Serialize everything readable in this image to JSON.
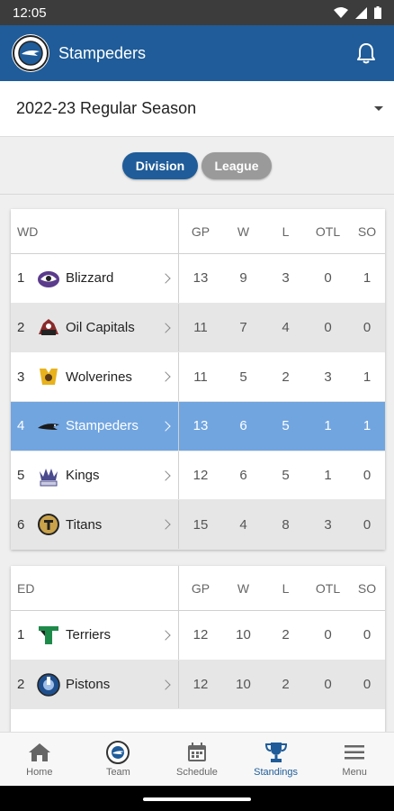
{
  "status_bar": {
    "time": "12:05"
  },
  "app_bar": {
    "title": "Stampeders"
  },
  "season_select": {
    "value": "2022-23 Regular Season"
  },
  "view_toggle": {
    "options": [
      {
        "label": "Division"
      },
      {
        "label": "League"
      }
    ]
  },
  "columns": [
    "GP",
    "W",
    "L",
    "OTL",
    "SO"
  ],
  "divisions": [
    {
      "name": "WD",
      "rows": [
        {
          "rank": "1",
          "team": "Blizzard",
          "logo": "blizzard-logo-icon",
          "gp": "13",
          "w": "9",
          "l": "3",
          "otl": "0",
          "so": "1"
        },
        {
          "rank": "2",
          "team": "Oil Capitals",
          "logo": "oil-capitals-logo-icon",
          "gp": "11",
          "w": "7",
          "l": "4",
          "otl": "0",
          "so": "0"
        },
        {
          "rank": "3",
          "team": "Wolverines",
          "logo": "wolverines-logo-icon",
          "gp": "11",
          "w": "5",
          "l": "2",
          "otl": "3",
          "so": "1"
        },
        {
          "rank": "4",
          "team": "Stampeders",
          "logo": "stampeders-logo-icon",
          "gp": "13",
          "w": "6",
          "l": "5",
          "otl": "1",
          "so": "1"
        },
        {
          "rank": "5",
          "team": "Kings",
          "logo": "kings-logo-icon",
          "gp": "12",
          "w": "6",
          "l": "5",
          "otl": "1",
          "so": "0"
        },
        {
          "rank": "6",
          "team": "Titans",
          "logo": "titans-logo-icon",
          "gp": "15",
          "w": "4",
          "l": "8",
          "otl": "3",
          "so": "0"
        }
      ]
    },
    {
      "name": "ED",
      "rows": [
        {
          "rank": "1",
          "team": "Terriers",
          "logo": "terriers-logo-icon",
          "gp": "12",
          "w": "10",
          "l": "2",
          "otl": "0",
          "so": "0"
        },
        {
          "rank": "2",
          "team": "Pistons",
          "logo": "pistons-logo-icon",
          "gp": "12",
          "w": "10",
          "l": "2",
          "otl": "0",
          "so": "0"
        }
      ]
    }
  ],
  "bottom_nav": [
    {
      "label": "Home",
      "icon": "home-icon"
    },
    {
      "label": "Team",
      "icon": "team-icon"
    },
    {
      "label": "Schedule",
      "icon": "calendar-icon"
    },
    {
      "label": "Standings",
      "icon": "trophy-icon"
    },
    {
      "label": "Menu",
      "icon": "menu-icon"
    }
  ],
  "colors": {
    "primary": "#1f5c99",
    "highlight_row": "#71a5e0",
    "inactive_pill": "#9a9a9a"
  }
}
